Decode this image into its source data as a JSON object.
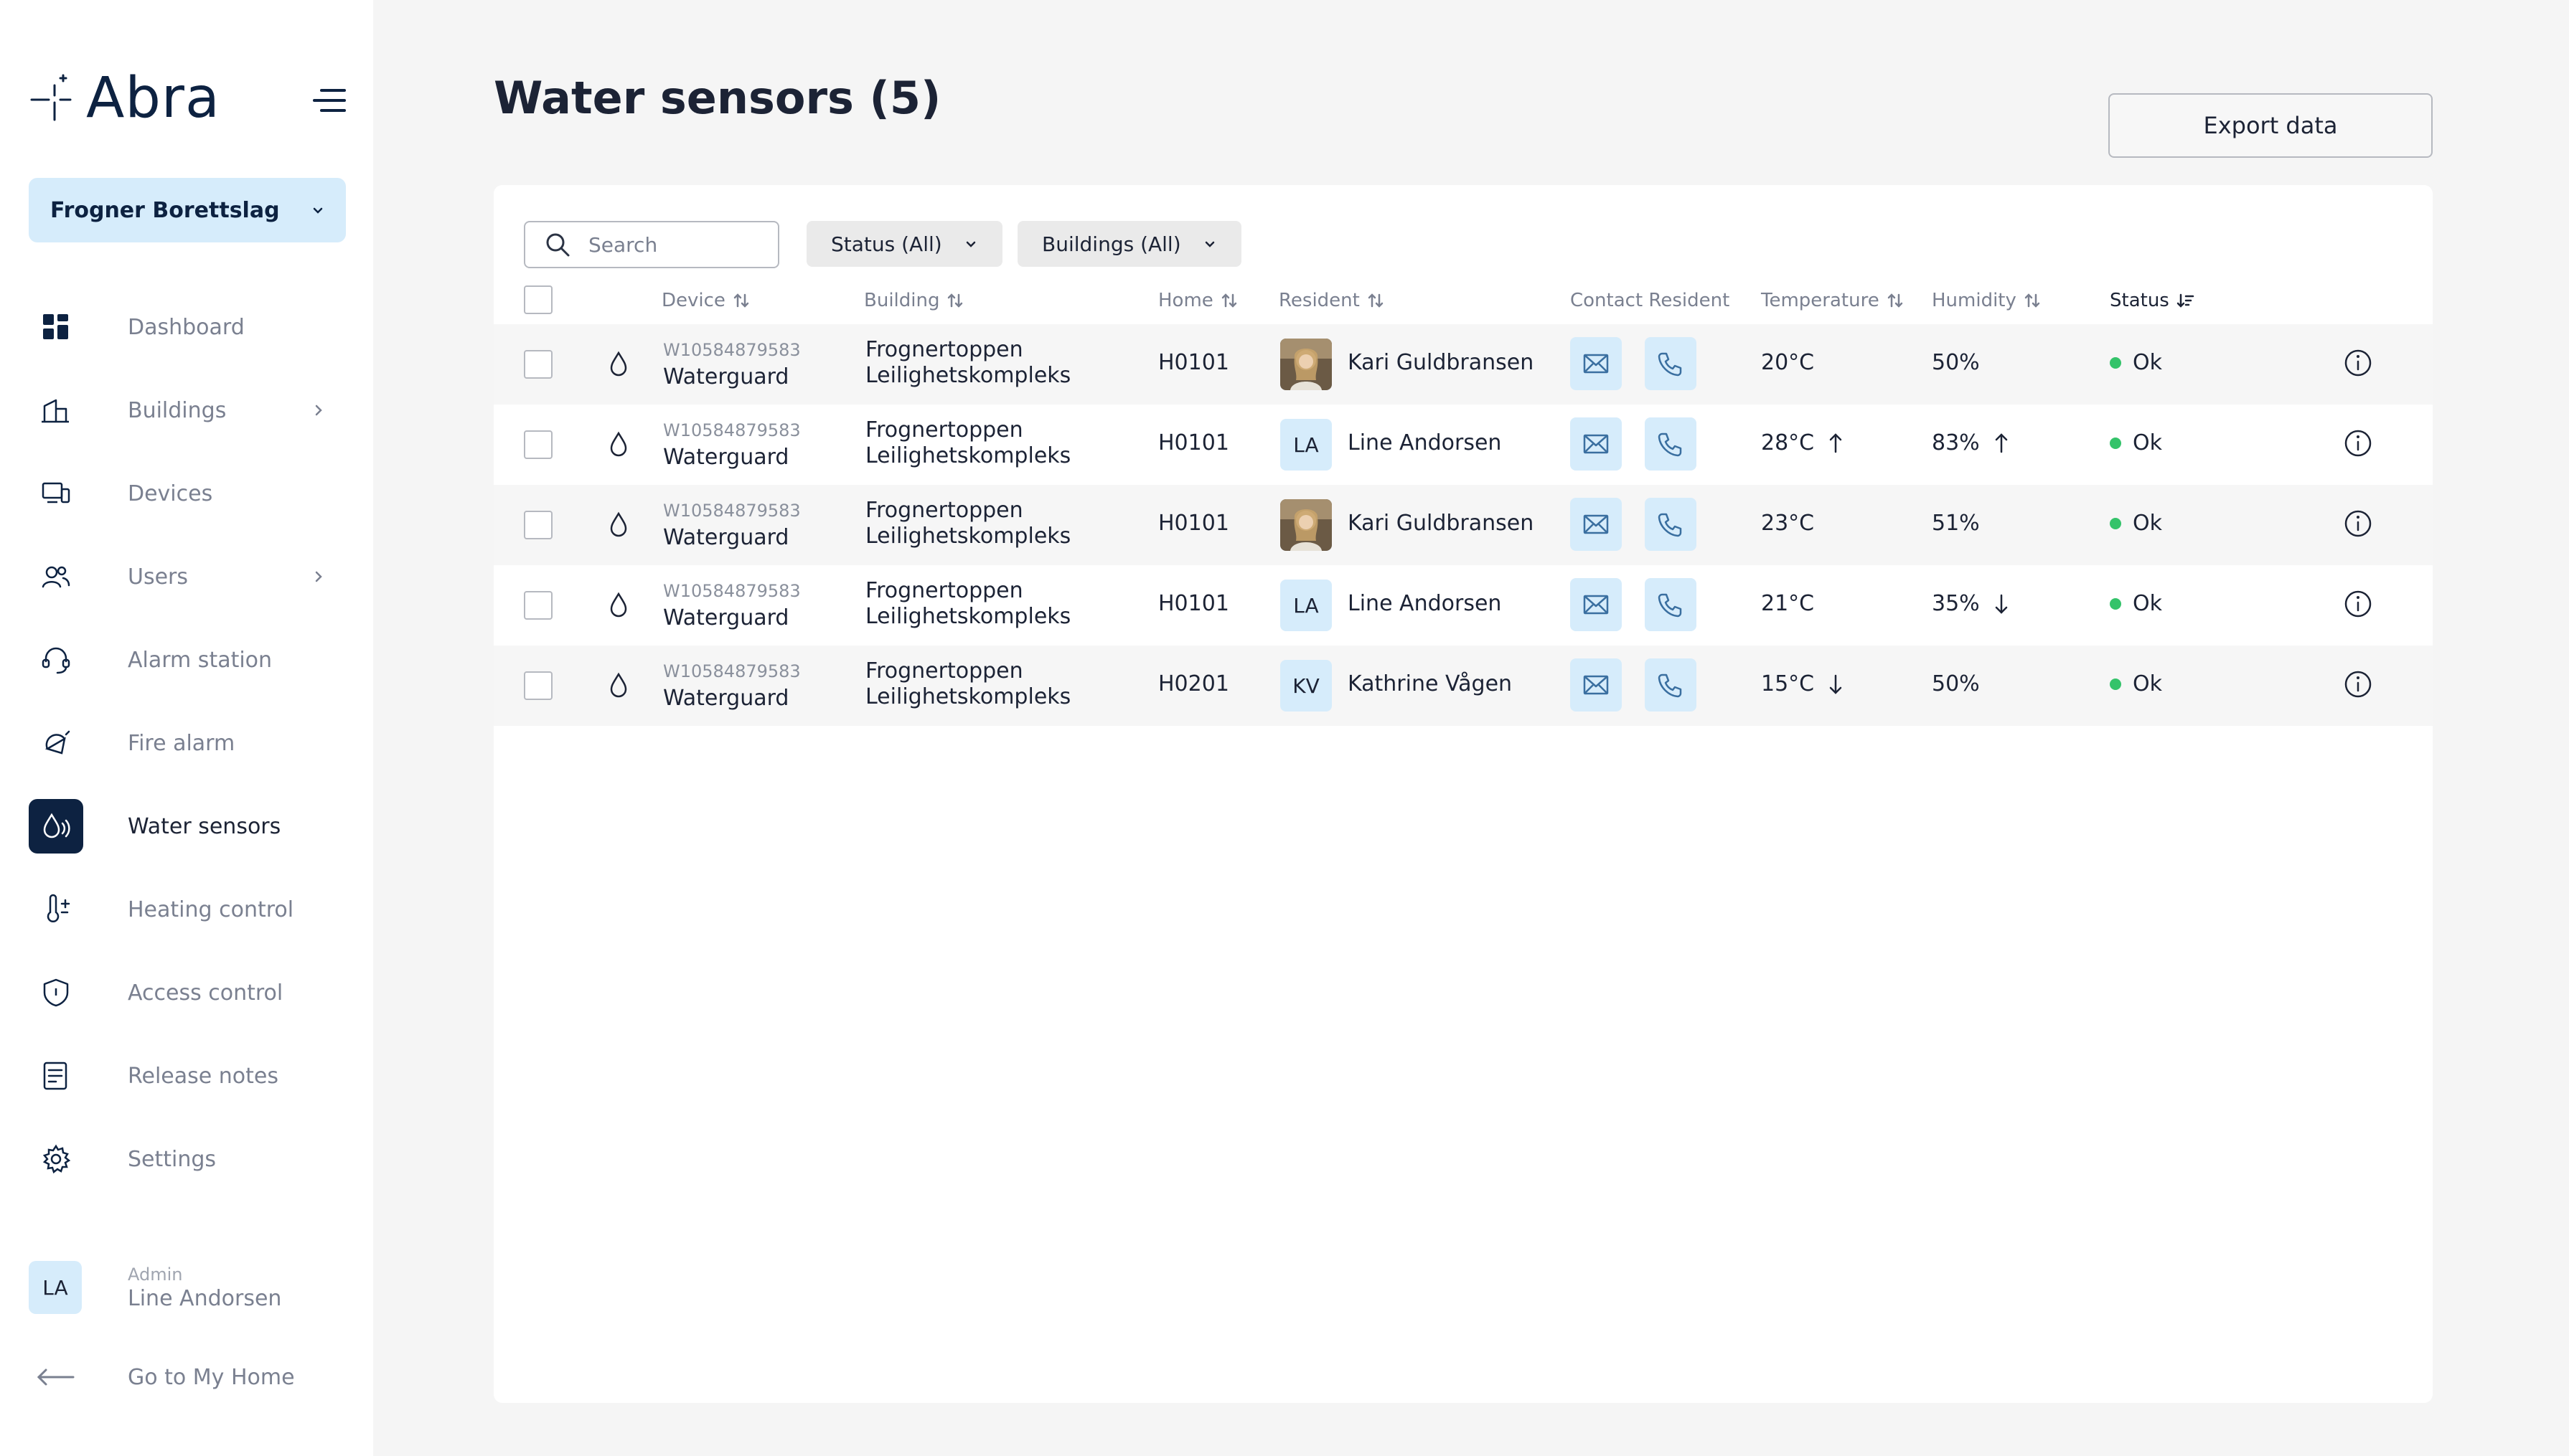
{
  "app": {
    "name": "Abra"
  },
  "org_select": {
    "label": "Frogner Borettslag"
  },
  "nav": [
    {
      "label": "Dashboard",
      "icon": "dashboard-icon",
      "chevron": false,
      "active": false
    },
    {
      "label": "Buildings",
      "icon": "building-icon",
      "chevron": true,
      "active": false
    },
    {
      "label": "Devices",
      "icon": "devices-icon",
      "chevron": false,
      "active": false
    },
    {
      "label": "Users",
      "icon": "users-icon",
      "chevron": true,
      "active": false
    },
    {
      "label": "Alarm station",
      "icon": "headset-icon",
      "chevron": false,
      "active": false
    },
    {
      "label": "Fire alarm",
      "icon": "fire-alarm-icon",
      "chevron": false,
      "active": false
    },
    {
      "label": "Water sensors",
      "icon": "water-sensor-icon",
      "chevron": false,
      "active": true
    },
    {
      "label": "Heating control",
      "icon": "thermometer-icon",
      "chevron": false,
      "active": false
    },
    {
      "label": "Access control",
      "icon": "shield-icon",
      "chevron": false,
      "active": false
    },
    {
      "label": "Release notes",
      "icon": "notes-icon",
      "chevron": false,
      "active": false
    },
    {
      "label": "Settings",
      "icon": "gear-icon",
      "chevron": false,
      "active": false
    }
  ],
  "user": {
    "initials": "LA",
    "role": "Admin",
    "name": "Line Andorsen"
  },
  "go_home": {
    "label": "Go to My Home"
  },
  "page": {
    "title": "Water sensors (5)",
    "export_label": "Export data"
  },
  "filters": {
    "search_placeholder": "Search",
    "status_label": "Status (All)",
    "buildings_label": "Buildings (All)"
  },
  "table": {
    "headers": {
      "device": "Device",
      "building": "Building",
      "home": "Home",
      "resident": "Resident",
      "contact": "Contact Resident",
      "temperature": "Temperature",
      "humidity": "Humidity",
      "status": "Status"
    },
    "rows": [
      {
        "device_id": "W10584879583",
        "device_name": "Waterguard",
        "building_line1": "Frognertoppen",
        "building_line2": "Leilighetskompleks",
        "home": "H0101",
        "resident_avatar": "photo",
        "resident_initials": "",
        "resident_name": "Kari Guldbransen",
        "temperature": "20°C",
        "temp_trend": "",
        "humidity": "50%",
        "hum_trend": "",
        "status": "Ok"
      },
      {
        "device_id": "W10584879583",
        "device_name": "Waterguard",
        "building_line1": "Frognertoppen",
        "building_line2": "Leilighetskompleks",
        "home": "H0101",
        "resident_avatar": "initials",
        "resident_initials": "LA",
        "resident_name": "Line Andorsen",
        "temperature": "28°C",
        "temp_trend": "up",
        "humidity": "83%",
        "hum_trend": "up",
        "status": "Ok"
      },
      {
        "device_id": "W10584879583",
        "device_name": "Waterguard",
        "building_line1": "Frognertoppen",
        "building_line2": "Leilighetskompleks",
        "home": "H0101",
        "resident_avatar": "photo",
        "resident_initials": "",
        "resident_name": "Kari Guldbransen",
        "temperature": "23°C",
        "temp_trend": "",
        "humidity": "51%",
        "hum_trend": "",
        "status": "Ok"
      },
      {
        "device_id": "W10584879583",
        "device_name": "Waterguard",
        "building_line1": "Frognertoppen",
        "building_line2": "Leilighetskompleks",
        "home": "H0101",
        "resident_avatar": "initials",
        "resident_initials": "LA",
        "resident_name": "Line Andorsen",
        "temperature": "21°C",
        "temp_trend": "",
        "humidity": "35%",
        "hum_trend": "down",
        "status": "Ok"
      },
      {
        "device_id": "W10584879583",
        "device_name": "Waterguard",
        "building_line1": "Frognertoppen",
        "building_line2": "Leilighetskompleks",
        "home": "H0201",
        "resident_avatar": "initials",
        "resident_initials": "KV",
        "resident_name": "Kathrine Vågen",
        "temperature": "15°C",
        "temp_trend": "down",
        "humidity": "50%",
        "hum_trend": "",
        "status": "Ok"
      }
    ]
  },
  "colors": {
    "brand_dark": "#0d2241",
    "accent_light": "#d6ecfb",
    "status_ok": "#34c36a",
    "muted_text": "#7a8090"
  }
}
